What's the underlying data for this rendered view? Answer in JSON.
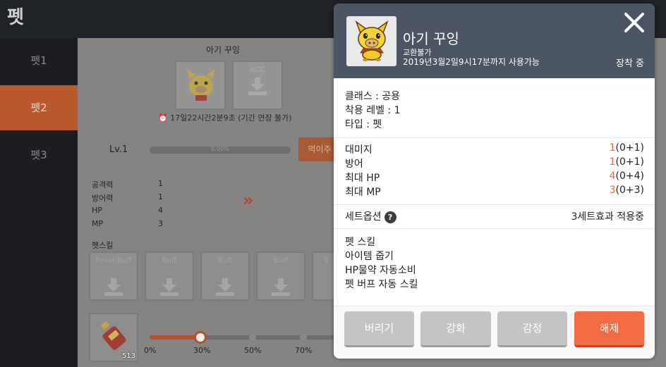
{
  "window": {
    "title": "펫"
  },
  "sidebar": {
    "items": [
      {
        "label": "펫1"
      },
      {
        "label": "펫2"
      },
      {
        "label": "펫3"
      }
    ]
  },
  "pet": {
    "name": "아기 꾸잉",
    "acc_label": "ACC",
    "timer": "17일22시간2분9초 (기간 연장 불가)",
    "level": "Lv.1",
    "exp_text": "0.00%",
    "exp_progress": 0.0,
    "feed_label": "먹이주",
    "stats": [
      {
        "label": "공격력",
        "value": "1"
      },
      {
        "label": "방어력",
        "value": "1"
      },
      {
        "label": "HP",
        "value": "4"
      },
      {
        "label": "MP",
        "value": "3"
      }
    ],
    "skills_title": "펫스킬",
    "skill_slots": [
      {
        "label": "Fever Buff"
      },
      {
        "label": "Buff"
      },
      {
        "label": "Buff"
      },
      {
        "label": "Buff"
      },
      {
        "label": "S"
      }
    ],
    "potion_count": "513",
    "potion_slider": {
      "value_percent": 30,
      "ticks": [
        "0%",
        "30%",
        "50%",
        "70%"
      ]
    }
  },
  "modal": {
    "name": "아기 꾸잉",
    "trade": "교환불가",
    "expire": "2019년3월2일9시17분까지 사용가능",
    "equipped": "장착 중",
    "info": [
      "클래스 : 공용",
      "착용 레벨 : 1",
      "타입 : 펫"
    ],
    "stats": [
      {
        "label": "대미지",
        "base": "1",
        "detail": "(0+1)"
      },
      {
        "label": "방어",
        "base": "1",
        "detail": "(0+1)"
      },
      {
        "label": "최대 HP",
        "base": "4",
        "detail": "(0+4)"
      },
      {
        "label": "최대 MP",
        "base": "3",
        "detail": "(0+3)"
      }
    ],
    "set_option_label": "세트옵션",
    "set_option_value": "3세트효과 적용중",
    "skills": [
      "펫 스킬",
      "아이템 줍기",
      "HP물약 자동소비",
      "펫 버프 자동 스킬"
    ],
    "buttons": {
      "discard": "버리기",
      "enhance": "강화",
      "appraise": "감정",
      "unequip": "해제"
    }
  },
  "colors": {
    "accent": "#f26b44",
    "header": "#4c5563",
    "sidebar_active": "#b8592f"
  },
  "icons": [
    "download-icon",
    "close-icon",
    "help-icon",
    "alarm-clock-icon",
    "double-chevron-right-icon",
    "pig-pet-icon",
    "potion-icon"
  ]
}
